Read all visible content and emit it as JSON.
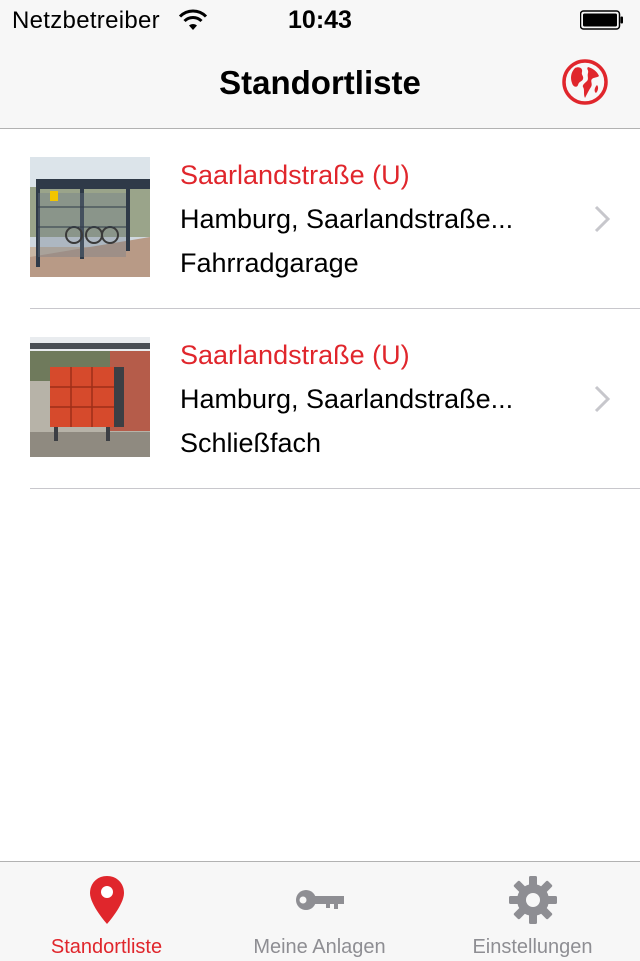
{
  "status_bar": {
    "carrier": "Netzbetreiber",
    "time": "10:43"
  },
  "nav": {
    "title": "Standortliste",
    "right_icon": "globe-icon"
  },
  "locations": [
    {
      "title": "Saarlandstraße (U)",
      "address": "Hamburg, Saarlandstraße...",
      "type": "Fahrradgarage",
      "thumbnail": "bike-garage-photo"
    },
    {
      "title": "Saarlandstraße (U)",
      "address": "Hamburg, Saarlandstraße...",
      "type": "Schließfach",
      "thumbnail": "locker-photo"
    }
  ],
  "tabs": [
    {
      "label": "Standortliste",
      "icon": "map-pin-icon",
      "active": true
    },
    {
      "label": "Meine Anlagen",
      "icon": "key-icon",
      "active": false
    },
    {
      "label": "Einstellungen",
      "icon": "gear-icon",
      "active": false
    }
  ],
  "colors": {
    "accent": "#e0262c",
    "inactive": "#8e8e93",
    "bar_background": "#f7f7f7"
  }
}
